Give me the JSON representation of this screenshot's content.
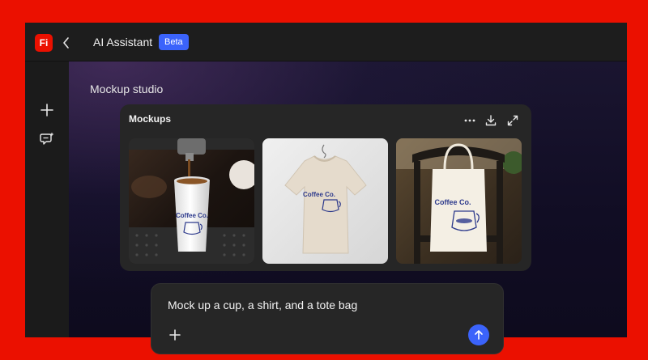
{
  "app": {
    "logo_text": "Fi",
    "title": "AI Assistant",
    "badge": "Beta"
  },
  "sidebar": {
    "items": [
      {
        "icon": "plus-icon"
      },
      {
        "icon": "chat-sparkle-icon"
      }
    ]
  },
  "main": {
    "section_title": "Mockup studio"
  },
  "mockups": {
    "title": "Mockups",
    "actions": [
      "more-icon",
      "download-icon",
      "expand-icon"
    ],
    "items": [
      {
        "name": "cup",
        "brand_text": "Coffee Co."
      },
      {
        "name": "shirt",
        "brand_text": "Coffee Co."
      },
      {
        "name": "tote-bag",
        "brand_text": "Coffee Co."
      }
    ]
  },
  "prompt": {
    "text": "Mock up a cup, a shirt, and a tote bag"
  },
  "colors": {
    "brand_red": "#eb1000",
    "accent_blue": "#3b63fb",
    "logo_ink": "#2d3a8c"
  }
}
